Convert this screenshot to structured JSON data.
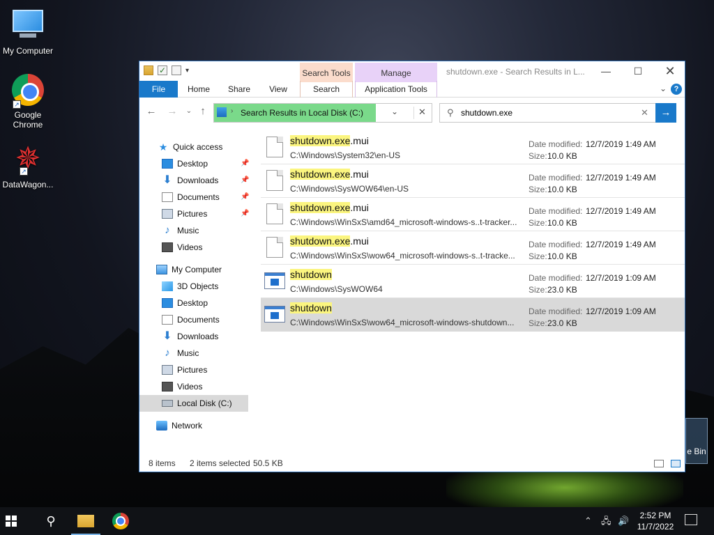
{
  "desktop": {
    "icons": [
      {
        "label": "My Computer",
        "icon": "computer-icon"
      },
      {
        "label": "Google Chrome",
        "icon": "chrome-icon"
      },
      {
        "label": "DataWagon...",
        "icon": "datawagon-icon"
      }
    ],
    "recycle_bin_label": "e Bin"
  },
  "window": {
    "title": "shutdown.exe - Search Results in L...",
    "context_tabs": {
      "search_tools": "Search Tools",
      "manage": "Manage"
    },
    "ribbon_tabs": [
      "File",
      "Home",
      "Share",
      "View",
      "Search",
      "Application Tools"
    ],
    "address": "Search Results in Local Disk (C:)",
    "search_value": "shutdown.exe",
    "accent": "#1979ca",
    "address_fill": "#7ad98a"
  },
  "nav": {
    "quick_access": "Quick access",
    "quick_items": [
      "Desktop",
      "Downloads",
      "Documents",
      "Pictures",
      "Music",
      "Videos"
    ],
    "my_computer": "My Computer",
    "pc_items": [
      "3D Objects",
      "Desktop",
      "Documents",
      "Downloads",
      "Music",
      "Pictures",
      "Videos",
      "Local Disk (C:)"
    ],
    "network": "Network"
  },
  "labels": {
    "date_modified": "Date modified:",
    "size": "Size:"
  },
  "results": [
    {
      "hl": "shutdown.exe",
      "rest": ".mui",
      "path": "C:\\Windows\\System32\\en-US",
      "date": "12/7/2019 1:49 AM",
      "size": "10.0 KB"
    },
    {
      "hl": "shutdown.exe",
      "rest": ".mui",
      "path": "C:\\Windows\\SysWOW64\\en-US",
      "date": "12/7/2019 1:49 AM",
      "size": "10.0 KB"
    },
    {
      "hl": "shutdown.exe",
      "rest": ".mui",
      "path": "C:\\Windows\\WinSxS\\amd64_microsoft-windows-s..t-tracker...",
      "date": "12/7/2019 1:49 AM",
      "size": "10.0 KB"
    },
    {
      "hl": "shutdown.exe",
      "rest": ".mui",
      "path": "C:\\Windows\\WinSxS\\wow64_microsoft-windows-s..t-tracke...",
      "date": "12/7/2019 1:49 AM",
      "size": "10.0 KB"
    },
    {
      "hl": "shutdown",
      "rest": "",
      "path": "C:\\Windows\\SysWOW64",
      "date": "12/7/2019 1:09 AM",
      "size": "23.0 KB"
    },
    {
      "hl": "shutdown",
      "rest": "",
      "path": "C:\\Windows\\WinSxS\\wow64_microsoft-windows-shutdown...",
      "date": "12/7/2019 1:09 AM",
      "size": "23.0 KB"
    }
  ],
  "status": {
    "items": "8 items",
    "selected": "2 items selected",
    "size": "50.5 KB"
  },
  "taskbar": {
    "time": "2:52 PM",
    "date": "11/7/2022"
  }
}
